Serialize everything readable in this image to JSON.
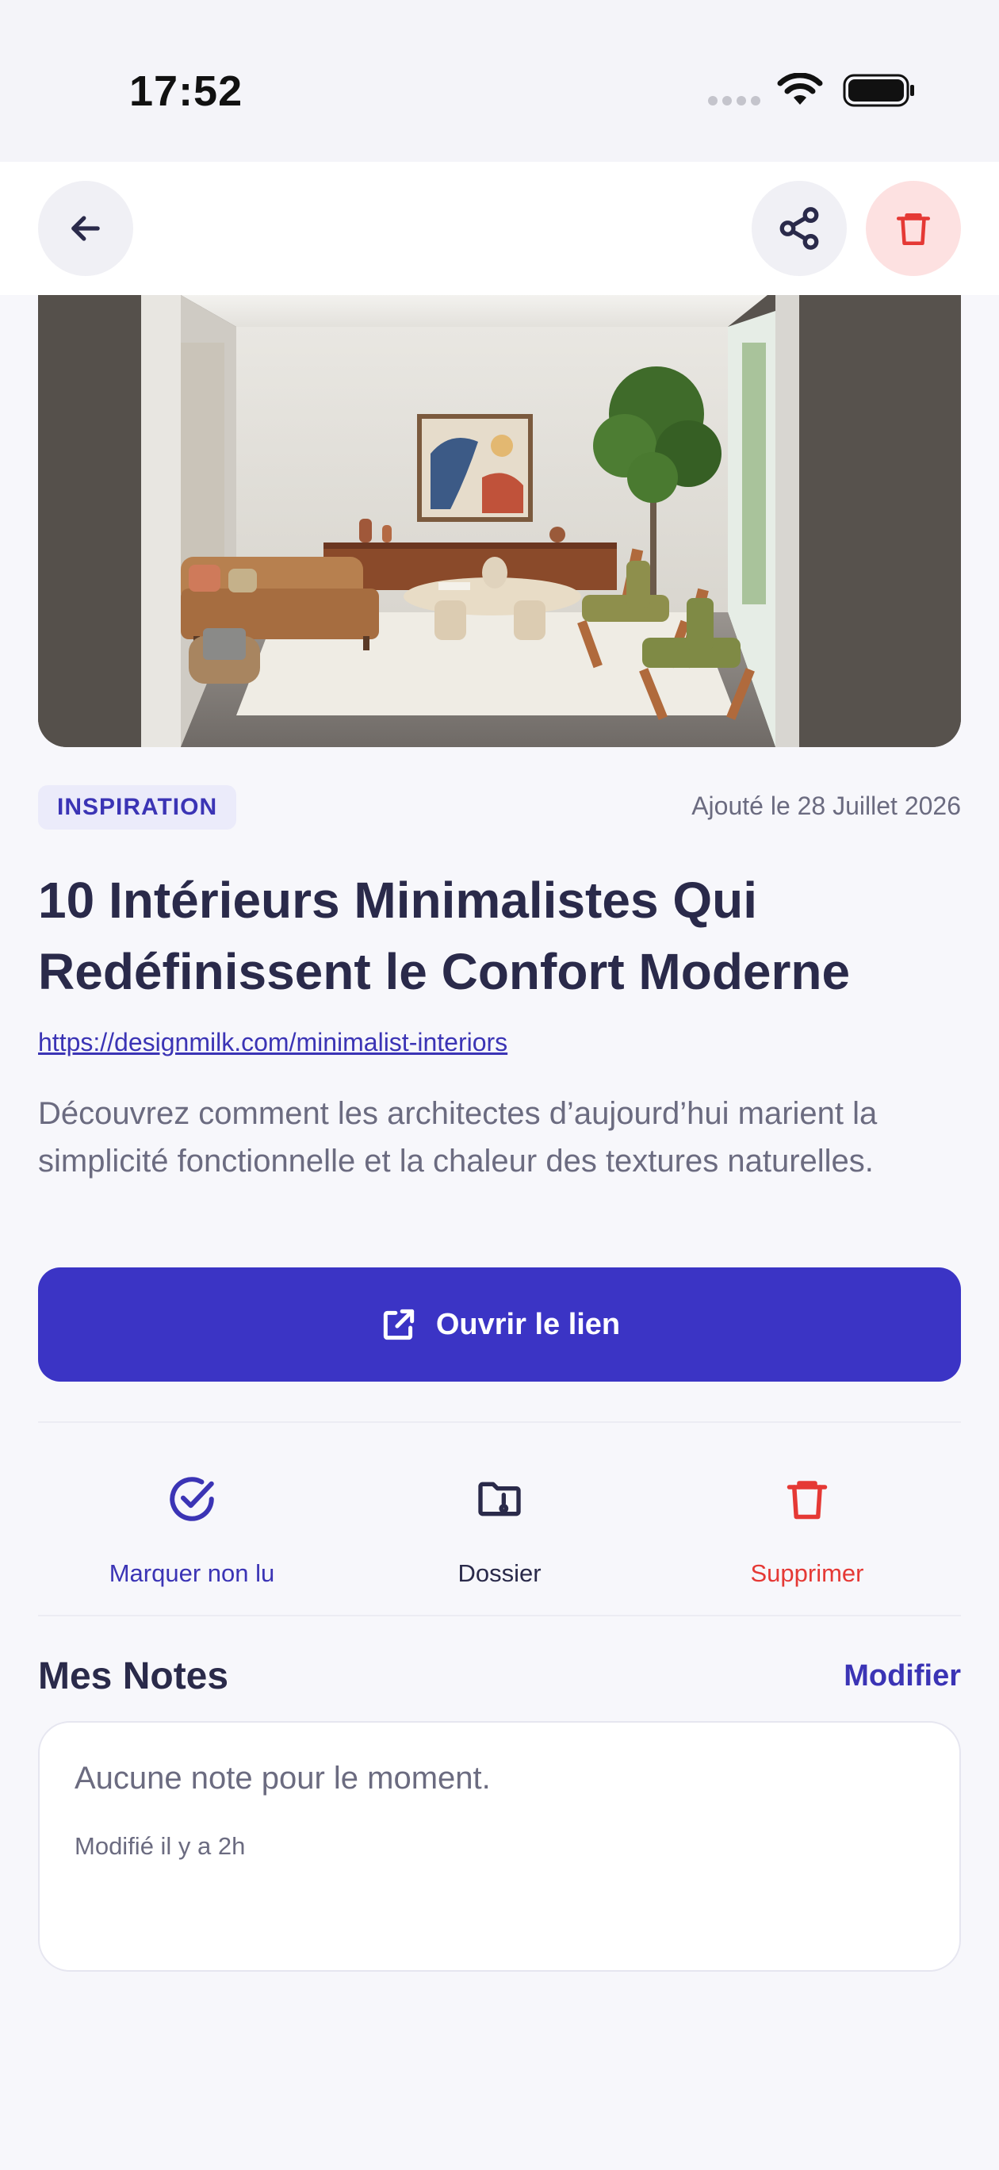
{
  "status_bar": {
    "time": "17:52"
  },
  "nav": {
    "back_icon": "arrow-left-icon",
    "share_icon": "share-icon",
    "delete_icon": "trash-icon"
  },
  "hero": {
    "image": "living-room-photo"
  },
  "article": {
    "category": "INSPIRATION",
    "added": "Ajouté le 28 Juillet 2026",
    "title": "10 Intérieurs Minimalistes Qui Redéfinissent le Confort Moderne",
    "url": "https://designmilk.com/minimalist-interiors",
    "description": "Découvrez comment les architectes d’aujourd’hui marient la simplicité fonctionnelle et la chaleur des textures naturelles."
  },
  "open_button": {
    "label": "Ouvrir le lien",
    "icon": "external-link-icon"
  },
  "actions": [
    {
      "label": "Marquer non lu",
      "icon": "check-circle-icon",
      "color": "#3b34b5"
    },
    {
      "label": "Dossier",
      "icon": "folder-icon",
      "color": "#2a2a4a"
    },
    {
      "label": "Supprimer",
      "icon": "trash-icon",
      "color": "#e53935"
    }
  ],
  "notes": {
    "heading": "Mes Notes",
    "edit_label": "Modifier",
    "placeholder": "Aucune note pour le moment.",
    "modified": "Modifié il y a 2h"
  },
  "colors": {
    "accent": "#3b34c5",
    "danger": "#e53935",
    "background": "#f7f7fb"
  }
}
